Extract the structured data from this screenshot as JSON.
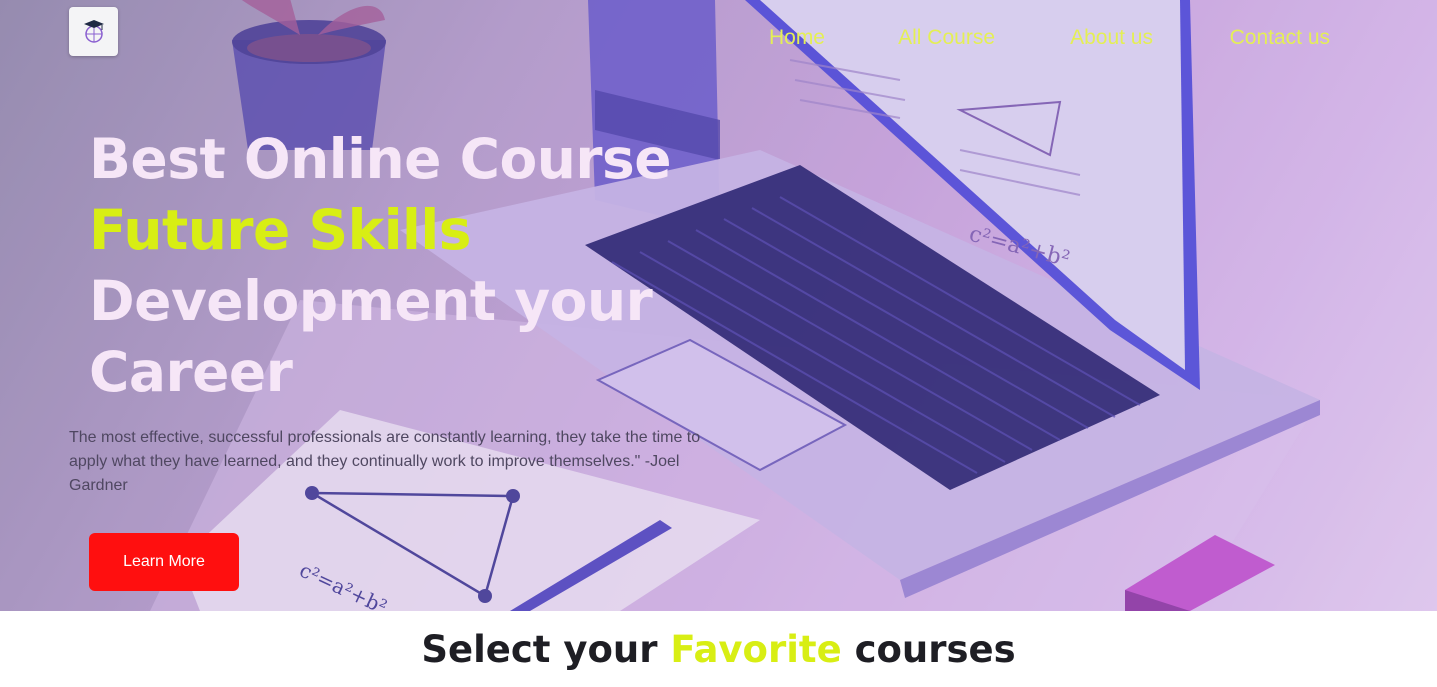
{
  "nav": {
    "logo_icon": "graduation-globe-logo",
    "links": [
      "Home",
      "All Course",
      "About us",
      "Contact us"
    ],
    "link_color": "#e4ef55"
  },
  "hero": {
    "title_line1": "Best Online Course",
    "title_line2": "Future Skills",
    "title_line3": "Development your",
    "title_line4": "Career",
    "quote": "The most effective, successful professionals are constantly learning, they take the time to apply what they have learned, and they continually work to improve themselves.\" -Joel Gardner",
    "cta_label": "Learn More",
    "accent_color": "#d8ee14",
    "cta_color": "#ff0f0f"
  },
  "courses_section": {
    "title_before": "Select your ",
    "title_accent": "Favorite",
    "title_after": " courses"
  }
}
